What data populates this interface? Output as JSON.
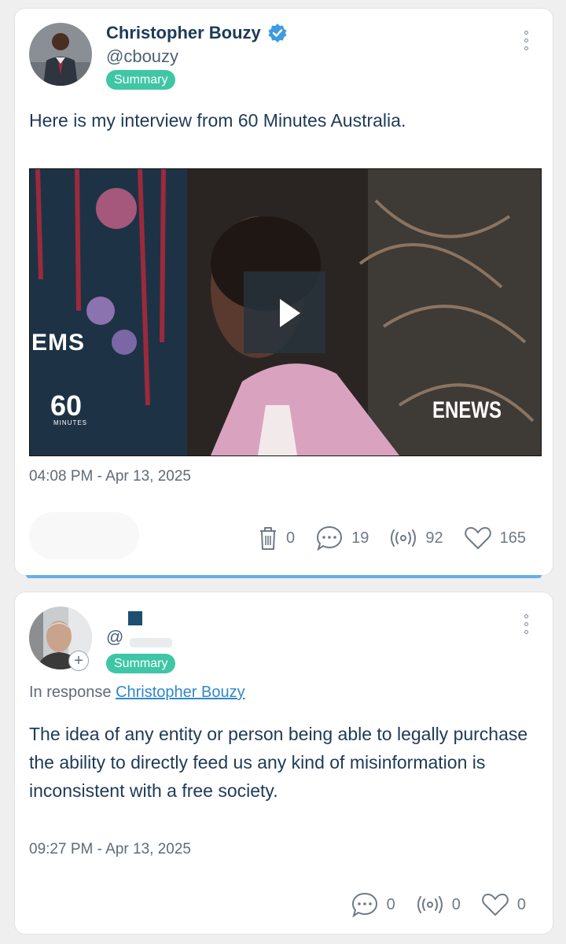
{
  "post1": {
    "author_name": "Christopher Bouzy",
    "handle": "@cbouzy",
    "badge": "Summary",
    "text": "Here is my interview from 60 Minutes Australia.",
    "timestamp": "04:08 PM - Apr 13, 2025",
    "video": {
      "left_logo_text": "60",
      "left_logo_sub": "MINUTES",
      "left_sign": "EMS",
      "right_logo_text": "ENEWS"
    },
    "stats": {
      "delete": "0",
      "replies": "19",
      "reposts": "92",
      "likes": "165"
    }
  },
  "post2": {
    "handle": "@",
    "badge": "Summary",
    "in_response_label": "In response",
    "in_response_name": "Christopher Bouzy",
    "text": "The idea of any entity or person being able to legally purchase the ability to directly feed us any kind of misinformation is inconsistent with a free society.",
    "timestamp": "09:27 PM - Apr 13, 2025",
    "follow_plus": "+",
    "stats": {
      "replies": "0",
      "reposts": "0",
      "likes": "0"
    }
  },
  "colors": {
    "verified": "#3f9be0",
    "badge": "#3fc6a5",
    "link": "#2f88c9",
    "divider": "#6aaee6"
  }
}
